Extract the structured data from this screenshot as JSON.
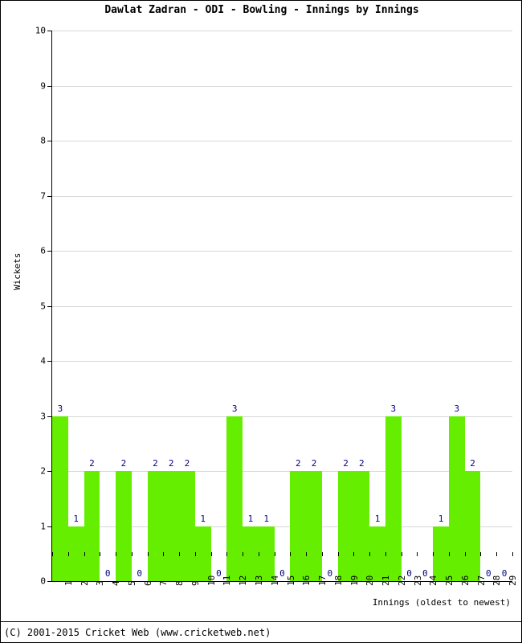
{
  "chart_data": {
    "type": "bar",
    "title": "Dawlat Zadran - ODI - Bowling - Innings by Innings",
    "xlabel": "Innings (oldest to newest)",
    "ylabel": "Wickets",
    "categories": [
      "1",
      "2",
      "3",
      "4",
      "5",
      "6",
      "7",
      "8",
      "9",
      "10",
      "11",
      "12",
      "13",
      "14",
      "15",
      "16",
      "17",
      "18",
      "19",
      "20",
      "21",
      "22",
      "23",
      "24",
      "25",
      "26",
      "27",
      "28",
      "29"
    ],
    "values": [
      3,
      1,
      2,
      0,
      2,
      0,
      2,
      2,
      2,
      1,
      0,
      3,
      1,
      1,
      0,
      2,
      2,
      0,
      2,
      2,
      1,
      3,
      0,
      0,
      1,
      3,
      2,
      0,
      0
    ],
    "bar_labels": [
      "3",
      "1",
      "2",
      "0",
      "2",
      "0",
      "2",
      "2",
      "2",
      "1",
      "0",
      "3",
      "1",
      "1",
      "0",
      "2",
      "2",
      "0",
      "2",
      "2",
      "1",
      "3",
      "0",
      "0",
      "1",
      "3",
      "2",
      "0",
      "0"
    ],
    "ylim": [
      0,
      10
    ],
    "yticks": [
      0,
      1,
      2,
      3,
      4,
      5,
      6,
      7,
      8,
      9,
      10
    ],
    "ytick_labels": [
      "0",
      "1",
      "2",
      "3",
      "4",
      "5",
      "6",
      "7",
      "8",
      "9",
      "10"
    ],
    "grid": true,
    "legend": null,
    "series_color": "#66ee00",
    "label_color": "#000080",
    "grid_color": "#d8d8d8",
    "axis_color": "#000000"
  },
  "footer": {
    "copyright": "(C) 2001-2015 Cricket Web (www.cricketweb.net)"
  }
}
